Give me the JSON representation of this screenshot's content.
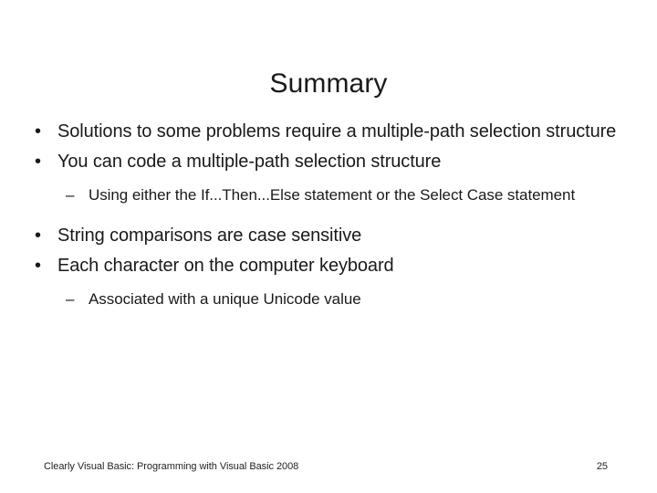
{
  "slide": {
    "title": "Summary",
    "bullet_marker": "•",
    "sub_marker": "–",
    "items": [
      {
        "level": 1,
        "text": "Solutions to some problems require a multiple-path selection structure"
      },
      {
        "level": 1,
        "text": "You can code a multiple-path selection structure"
      },
      {
        "level": 2,
        "text": "Using either the If...Then...Else statement or the Select Case statement"
      },
      {
        "level": 1,
        "text": "String comparisons are case sensitive"
      },
      {
        "level": 1,
        "text": "Each character on the computer keyboard"
      },
      {
        "level": 2,
        "text": "Associated with a unique Unicode value"
      }
    ],
    "footer": {
      "source": "Clearly Visual Basic: Programming with Visual Basic 2008",
      "page_number": "25"
    },
    "colors": {
      "background": "#ffffff",
      "text": "#1a1a1a",
      "footer_text": "#232323"
    }
  }
}
